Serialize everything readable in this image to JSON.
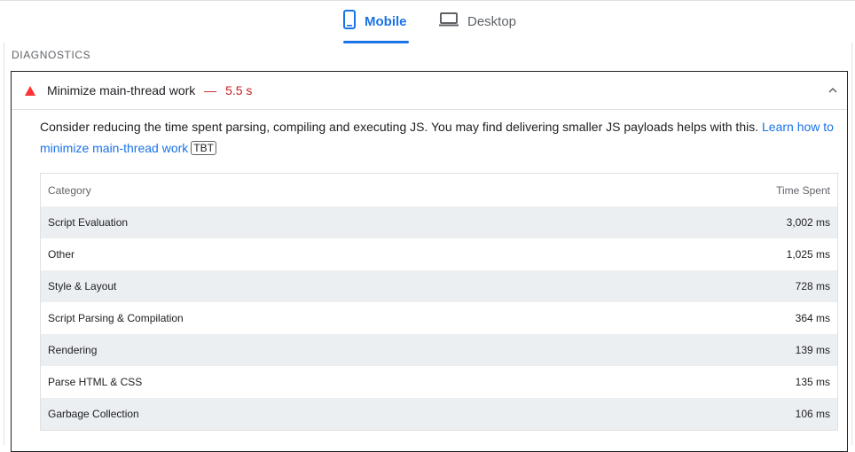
{
  "tabs": {
    "mobile_label": "Mobile",
    "desktop_label": "Desktop",
    "active": "Mobile"
  },
  "section": {
    "title": "DIAGNOSTICS"
  },
  "audit": {
    "title": "Minimize main-thread work",
    "separator": "—",
    "display_value": "5.5 s",
    "status": "fail",
    "expanded": true,
    "description_text": "Consider reducing the time spent parsing, compiling and executing JS. You may find delivering smaller JS payloads helps with this. ",
    "learn_more_link": "Learn how to minimize main-thread work",
    "badge": "TBT"
  },
  "table": {
    "headers": {
      "category": "Category",
      "time": "Time Spent"
    },
    "rows": [
      {
        "category": "Script Evaluation",
        "time": "3,002 ms"
      },
      {
        "category": "Other",
        "time": "1,025 ms"
      },
      {
        "category": "Style & Layout",
        "time": "728 ms"
      },
      {
        "category": "Script Parsing & Compilation",
        "time": "364 ms"
      },
      {
        "category": "Rendering",
        "time": "139 ms"
      },
      {
        "category": "Parse HTML & CSS",
        "time": "135 ms"
      },
      {
        "category": "Garbage Collection",
        "time": "106 ms"
      }
    ]
  },
  "colors": {
    "accent": "#1a73e8",
    "fail": "#ff3333",
    "fail_text": "#c5221f",
    "row_stripe": "#eceff1"
  }
}
